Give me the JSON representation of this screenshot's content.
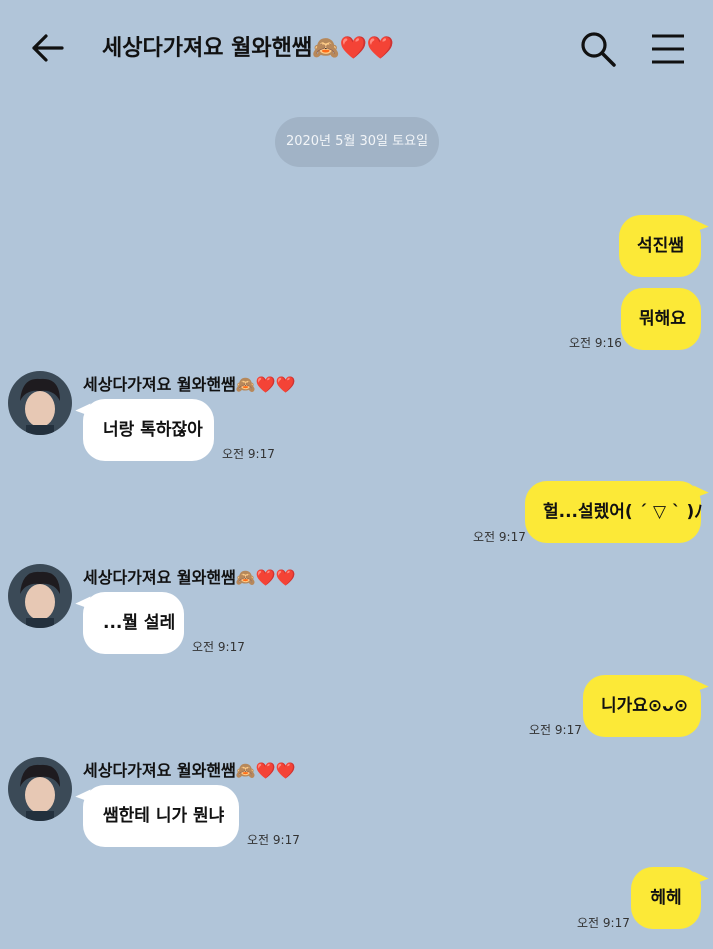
{
  "header": {
    "title": "세상다가져요 월와핸쌤🙈❤️❤️"
  },
  "date_divider": "2020년 5월 30일 토요일",
  "messages": [
    {
      "sender": "me",
      "text": "석진쌤",
      "time": ""
    },
    {
      "sender": "me",
      "text": "뭐해요",
      "time": "오전 9:16"
    },
    {
      "sender": "세상다가져요 월와핸쌤🙈❤️❤️",
      "text": "너랑 톡하잖아",
      "time": "오전 9:17"
    },
    {
      "sender": "me",
      "text": "헐...설렜어( ´ ▽ ` )ﾉ",
      "time": "오전 9:17"
    },
    {
      "sender": "세상다가져요 월와핸쌤🙈❤️❤️",
      "text": "...뭘 설레",
      "time": "오전 9:17"
    },
    {
      "sender": "me",
      "text": "니가요⊙ᴗ⊙",
      "time": "오전 9:17"
    },
    {
      "sender": "세상다가져요 월와핸쌤🙈❤️❤️",
      "text": "쌤한테 니가 뭔냐",
      "time": "오전 9:17"
    },
    {
      "sender": "me",
      "text": "헤헤",
      "time": "오전 9:17"
    }
  ],
  "colors": {
    "background": "#b1c5d9",
    "my_bubble": "#fce937",
    "their_bubble": "#ffffff",
    "date_pill": "#a1b3c6"
  },
  "icons": {
    "back": "arrow-left-icon",
    "search": "search-icon",
    "menu": "hamburger-menu-icon",
    "avatar": "profile-avatar"
  }
}
